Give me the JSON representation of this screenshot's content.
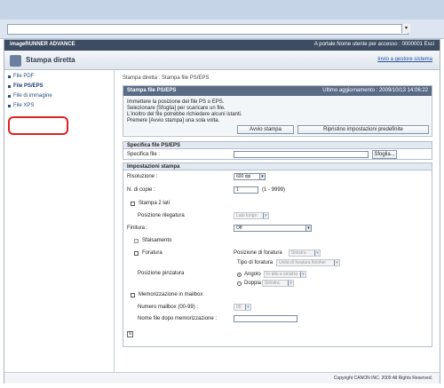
{
  "browser": {
    "url_value": ""
  },
  "app": {
    "brand": "imageRUNNER ADVANCE",
    "header_right": "A portale   Nome utente per accesso : 0000001 Esci"
  },
  "title_bar": {
    "title": "Stampa diretta",
    "link": "Invio a gestore sistema"
  },
  "sidebar": {
    "items": [
      {
        "label": "File PDF"
      },
      {
        "label": "File PS/EPS"
      },
      {
        "label": "File di immagine"
      },
      {
        "label": "File XPS"
      }
    ]
  },
  "breadcrumb": "Stampa diretta : Stampa file PS/EPS",
  "panel": {
    "title": "Stampa file PS/EPS",
    "updated": "Ultimo aggiornamento : 2009/10/13 14:06:22",
    "info_lines": [
      "Immettere la posizione del file PS o EPS.",
      "Selezionare [Sfoglia] per scaricare un file.",
      "L'inoltro del file potrebbe richiedere alcuni istanti.",
      "Premere [Avvio stampa] una sola volta."
    ],
    "btn_start": "Avvio stampa",
    "btn_reset": "Ripristino impostazioni predefinite"
  },
  "file_spec": {
    "section": "Specifica file PS/EPS",
    "label": "Specifica file :",
    "value": "",
    "browse": "Sfoglia..."
  },
  "print_settings": {
    "section": "Impostazioni stampa",
    "resolution_label": "Risoluzione :",
    "resolution_value": "600 dpi",
    "copies_label": "N. di copie :",
    "copies_value": "1",
    "copies_range": "(1 - 9999)",
    "duplex_label": "Stampa 2 lati",
    "binding_label": "Posizione rilegatura",
    "binding_value": "Lato lungo",
    "finishing_label": "Finitura :",
    "finishing_value": "Off",
    "offset_label": "Sfalsamento",
    "punch_label": "Foratura",
    "punch_pos_label": "Posizione di foratura",
    "punch_pos_value": "Sinistra",
    "punch_type_label": "Tipo di foratura",
    "punch_type_value": "Unità di foratura finisher",
    "staple_label": "Posizione pinzatura",
    "corner_label": "Angolo",
    "corner_value": "In alto a sinistra",
    "double_label": "Doppia",
    "double_value": "Sinistra",
    "mailbox_label": "Memorizzazione in mailbox",
    "mailbox_num_label": "Numero mailbox (00-99) :",
    "mailbox_num_value": "00",
    "filename_label": "Nome file dopo memorizzazione :",
    "filename_value": ""
  },
  "footer": "Copyright CANON INC. 2009 All Rights Reserved."
}
